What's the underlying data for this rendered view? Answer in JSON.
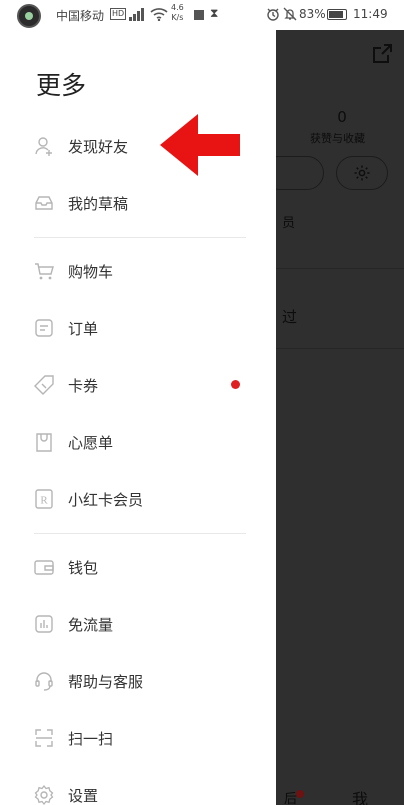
{
  "status_bar": {
    "carrier": "中国移动",
    "hd_badge": "HD",
    "network_speed": "4.6\nK/s",
    "battery_percent": "83%",
    "time": "11:49",
    "hour_glass": "⧗"
  },
  "drawer": {
    "title": "更多",
    "items": [
      {
        "label": "发现好友",
        "icon": "add-friend-icon"
      },
      {
        "label": "我的草稿",
        "icon": "drafts-icon"
      },
      {
        "label": "购物车",
        "icon": "cart-icon"
      },
      {
        "label": "订单",
        "icon": "orders-icon"
      },
      {
        "label": "卡券",
        "icon": "coupon-icon",
        "badge": true
      },
      {
        "label": "心愿单",
        "icon": "wishlist-icon"
      },
      {
        "label": "小红卡会员",
        "icon": "membership-icon"
      },
      {
        "label": "钱包",
        "icon": "wallet-icon"
      },
      {
        "label": "免流量",
        "icon": "data-free-icon"
      },
      {
        "label": "帮助与客服",
        "icon": "support-icon"
      },
      {
        "label": "扫一扫",
        "icon": "scan-icon"
      },
      {
        "label": "设置",
        "icon": "settings-icon"
      }
    ]
  },
  "background": {
    "count": "0",
    "likes_label": "获赞与收藏",
    "member_fragment": "员",
    "guo_fragment": "过",
    "bottom_left": "后",
    "bottom_me": "我"
  },
  "colors": {
    "accent_red": "#e02020",
    "overlay": "#2f2f2f"
  }
}
